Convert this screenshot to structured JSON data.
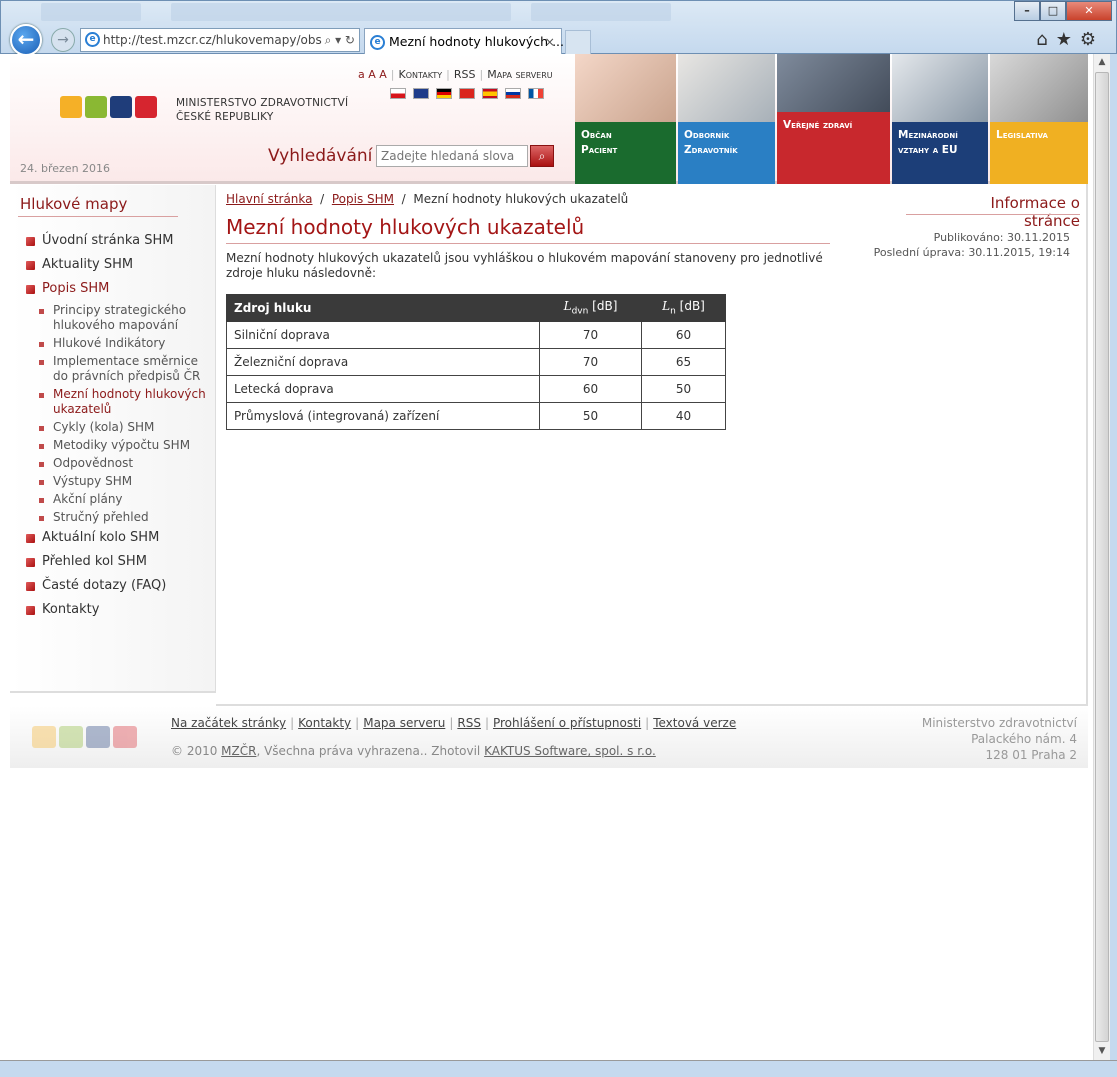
{
  "browser": {
    "url": "http://test.mzcr.cz/hlukovemapy/obs",
    "tab_title": "Mezní hodnoty hlukových ...",
    "tab_close": "×",
    "addr_tools": "⌕ ▾ ↻"
  },
  "header": {
    "ministry_line1": "Ministerstvo zdravotnictví",
    "ministry_line2": "České republiky",
    "date": "24. březen 2016",
    "font_sizes": "a A A",
    "links": [
      "Kontakty",
      "RSS",
      "Mapa serveru"
    ],
    "search_label": "Vyhledávání",
    "search_placeholder": "Zadejte hledaná slova",
    "tiles": [
      {
        "line1": "Občan",
        "line2": "Pacient",
        "color": "#1a6b2e"
      },
      {
        "line1": "Odborník",
        "line2": "Zdravotník",
        "color": "#2a7fc4"
      },
      {
        "line1": "Veřejné zdraví",
        "line2": "",
        "color": "#c8282d"
      },
      {
        "line1": "Mezinárodní",
        "line2": "vztahy a EU",
        "color": "#1c3e78"
      },
      {
        "line1": "Legislativa",
        "line2": "",
        "color": "#f0b022"
      }
    ]
  },
  "sidebar": {
    "title": "Hlukové mapy",
    "items": [
      {
        "label": "Úvodní stránka SHM",
        "level": 1,
        "active": false
      },
      {
        "label": "Aktuality SHM",
        "level": 1,
        "active": false
      },
      {
        "label": "Popis SHM",
        "level": 1,
        "active": true
      },
      {
        "label": "Principy strategického hlukového mapování",
        "level": 2,
        "active": false
      },
      {
        "label": "Hlukové Indikátory",
        "level": 2,
        "active": false
      },
      {
        "label": "Implementace směrnice do právních předpisů ČR",
        "level": 2,
        "active": false
      },
      {
        "label": "Mezní hodnoty hlukových ukazatelů",
        "level": 2,
        "active": true
      },
      {
        "label": "Cykly (kola) SHM",
        "level": 2,
        "active": false
      },
      {
        "label": "Metodiky výpočtu SHM",
        "level": 2,
        "active": false
      },
      {
        "label": "Odpovědnost",
        "level": 2,
        "active": false
      },
      {
        "label": "Výstupy SHM",
        "level": 2,
        "active": false
      },
      {
        "label": "Akční plány",
        "level": 2,
        "active": false
      },
      {
        "label": "Stručný přehled",
        "level": 2,
        "active": false
      },
      {
        "label": "Aktuální kolo SHM",
        "level": 1,
        "active": false
      },
      {
        "label": "Přehled kol SHM",
        "level": 1,
        "active": false
      },
      {
        "label": "Časté dotazy (FAQ)",
        "level": 1,
        "active": false
      },
      {
        "label": "Kontakty",
        "level": 1,
        "active": false
      }
    ]
  },
  "main": {
    "breadcrumb": {
      "home": "Hlavní stránka",
      "parent": "Popis SHM",
      "current": "Mezní hodnoty hlukových ukazatelů"
    },
    "title": "Mezní hodnoty hlukových ukazatelů",
    "intro": "Mezní hodnoty hlukových ukazatelů jsou vyhláškou o hlukovém mapování stanoveny pro jednotlivé zdroje hluku následovně:",
    "table": {
      "headers": {
        "source": "Zdroj hluku",
        "ldvn_sym": "L",
        "ldvn_sub": "dvn",
        "ldvn_unit": " [dB]",
        "ln_sym": "L",
        "ln_sub": "n",
        "ln_unit": " [dB]"
      },
      "rows": [
        {
          "source": "Silniční doprava",
          "ldvn": "70",
          "ln": "60"
        },
        {
          "source": "Železniční doprava",
          "ldvn": "70",
          "ln": "65"
        },
        {
          "source": "Letecká doprava",
          "ldvn": "60",
          "ln": "50"
        },
        {
          "source": "Průmyslová (integrovaná) zařízení",
          "ldvn": "50",
          "ln": "40"
        }
      ]
    }
  },
  "info": {
    "title": "Informace o stránce",
    "published": "Publikováno: 30.11.2015",
    "modified": "Poslední úprava: 30.11.2015, 19:14"
  },
  "footer": {
    "links": [
      "Na začátek stránky",
      "Kontakty",
      "Mapa serveru",
      "RSS",
      "Prohlášení o přístupnosti",
      "Textová verze"
    ],
    "copyright_pre": "© 2010 ",
    "copyright_org": "MZČR",
    "copyright_mid": ", Všechna práva vyhrazena.. Zhotovil ",
    "copyright_vendor": "KAKTUS Software, spol. s r.o.",
    "address": [
      "Ministerstvo zdravotnictví",
      "Palackého nám. 4",
      "128 01 Praha 2"
    ]
  },
  "colors": {
    "accent": "#8c1a1a",
    "title_red": "#a31515"
  }
}
